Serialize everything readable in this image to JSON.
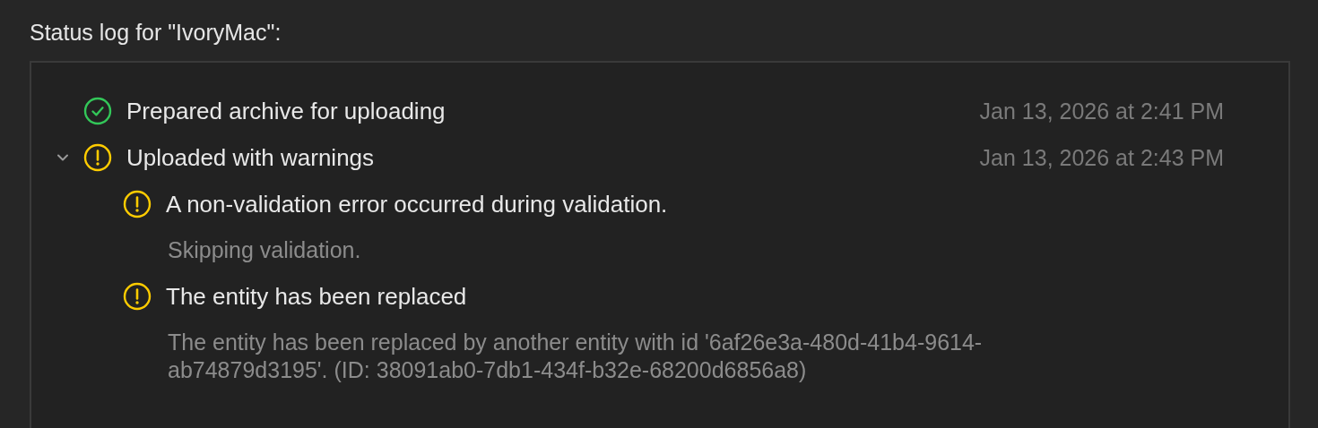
{
  "heading": "Status log for \"IvoryMac\":",
  "entries": [
    {
      "kind": "success",
      "title": "Prepared archive for uploading",
      "time": "Jan 13, 2026 at 2:41 PM"
    },
    {
      "kind": "warning",
      "title": "Uploaded with warnings",
      "time": "Jan 13, 2026 at 2:43 PM",
      "expanded": true,
      "children": [
        {
          "kind": "warning",
          "title": "A non-validation error occurred during validation.",
          "detail": "Skipping validation."
        },
        {
          "kind": "warning",
          "title": "The entity has been replaced",
          "detail": "The entity has been replaced by another entity with id '6af26e3a-480d-41b4-9614-ab74879d3195'. (ID: 38091ab0-7db1-434f-b32e-68200d6856a8)"
        }
      ]
    }
  ]
}
